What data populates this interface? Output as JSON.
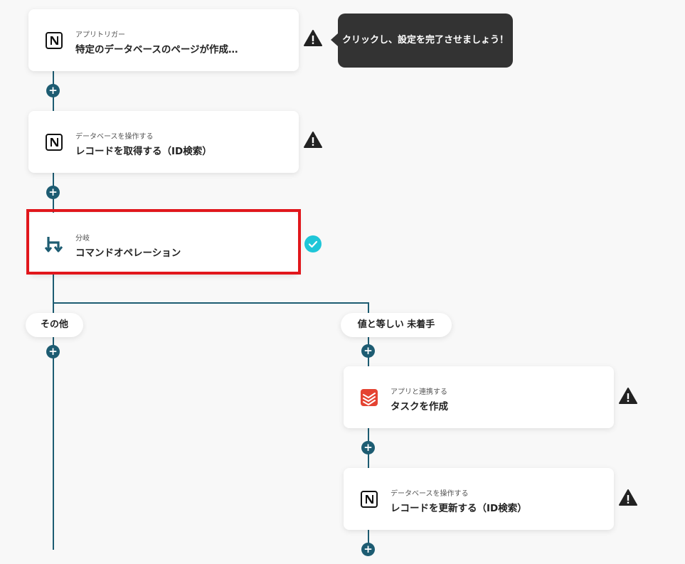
{
  "tooltip": {
    "text": "クリックし、設定を完了させましょう！"
  },
  "steps": [
    {
      "sub": "アプリトリガー",
      "title": "特定のデータベースのページが作成…",
      "icon": "notion-icon",
      "status": "warning"
    },
    {
      "sub": "データベースを操作する",
      "title": "レコードを取得する（ID検索）",
      "icon": "notion-icon",
      "status": "warning"
    },
    {
      "sub": "分岐",
      "title": "コマンドオペレーション",
      "icon": "branch-icon",
      "status": "complete"
    }
  ],
  "branches": [
    {
      "label": "その他"
    },
    {
      "label": "値と等しい 未着手",
      "steps": [
        {
          "sub": "アプリと連携する",
          "title": "タスクを作成",
          "icon": "todoist-icon",
          "status": "warning"
        },
        {
          "sub": "データベースを操作する",
          "title": "レコードを更新する（ID検索）",
          "icon": "notion-icon",
          "status": "warning"
        }
      ]
    }
  ],
  "colors": {
    "connector": "#1d5c72",
    "highlight": "#e1171c",
    "check": "#1fc6d8",
    "warning": "#222222",
    "todoist": "#e44332"
  }
}
